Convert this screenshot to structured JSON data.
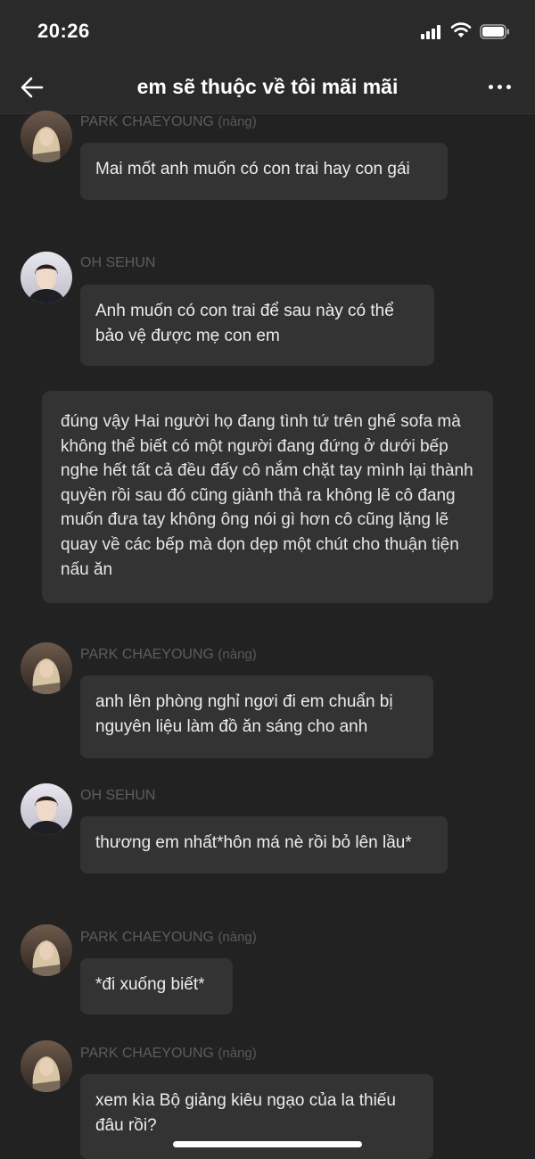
{
  "status_bar": {
    "time": "20:26"
  },
  "nav": {
    "title": "em sẽ thuộc về tôi mãi mãi"
  },
  "messages": [
    {
      "sender": "PARK CHAEYOUNG",
      "tag": "(nàng)",
      "text": "Mai mốt anh muốn có con trai hay con gái"
    },
    {
      "sender": "OH SEHUN",
      "text": "Anh muốn có con trai để sau này có thể bảo vệ được mẹ con em"
    },
    {
      "sender": "PARK CHAEYOUNG",
      "tag": "(nàng)",
      "text": "anh lên phòng nghỉ ngơi đi em chuẩn bị nguyên liệu làm đồ ăn sáng cho anh"
    },
    {
      "sender": "OH SEHUN",
      "text": "thương em nhất*hôn má nè rồi bỏ lên lầu*"
    },
    {
      "sender": "PARK CHAEYOUNG",
      "tag": "(nàng)",
      "text": "*đi xuống biết*"
    },
    {
      "sender": "PARK CHAEYOUNG",
      "tag": "(nàng)",
      "text": "xem kìa Bộ giảng kiêu ngạo của la thiếu đâu rồi?"
    }
  ],
  "narration": "đúng vậy Hai người họ đang tình tứ trên ghế sofa mà không thể biết có một người đang đứng ở dưới bếp nghe hết tất cả đều đấy cô nắm chặt tay mình lại thành quyền rồi sau đó cũng giành thả ra không lẽ cô đang muốn đưa tay không ông nói gì hơn cô cũng lặng lẽ quay về các bếp mà dọn dẹp một chút cho thuận tiện nấu ăn",
  "icons": {
    "back": "arrow-left-icon",
    "more": "more-horizontal-icon",
    "signal": "cellular-signal-icon",
    "wifi": "wifi-icon",
    "battery": "battery-icon"
  },
  "colors": {
    "background": "#222222",
    "bubble": "#333333",
    "sender_name": "#5d5d5d",
    "text": "#ececec"
  }
}
